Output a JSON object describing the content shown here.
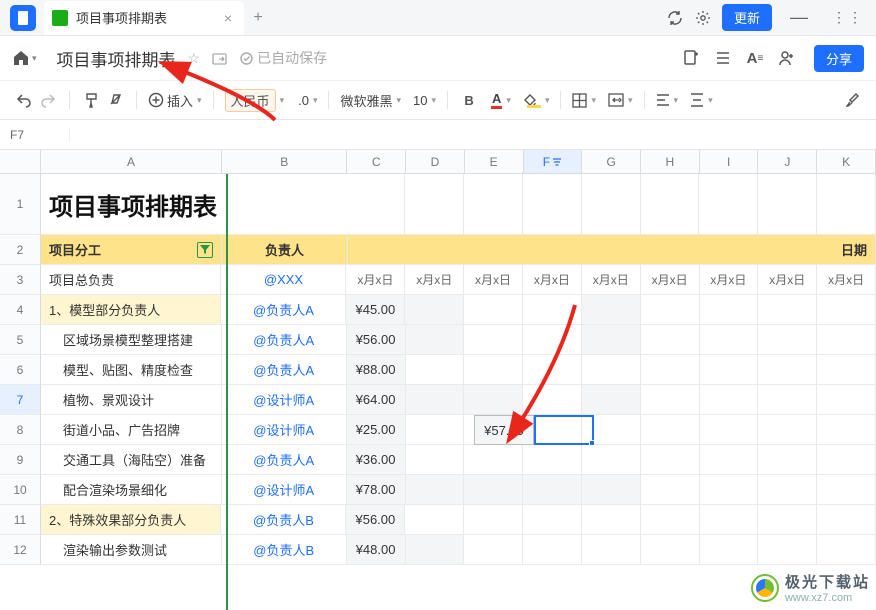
{
  "tabbar": {
    "title": "项目事项排期表",
    "update": "更新"
  },
  "titlebar": {
    "doc_title": "项目事项排期表",
    "autosave": "已自动保存",
    "share": "分享"
  },
  "toolbar": {
    "insert": "插入",
    "currency": "人民币",
    "decimal": ".0",
    "font": "微软雅黑",
    "font_size": "10"
  },
  "cellref": "F7",
  "columns": [
    "A",
    "B",
    "C",
    "D",
    "E",
    "F",
    "G",
    "H",
    "I",
    "J",
    "K"
  ],
  "rows": [
    "1",
    "2",
    "3",
    "4",
    "5",
    "6",
    "7",
    "8",
    "9",
    "10",
    "11",
    "12"
  ],
  "sheet": {
    "title": "项目事项排期表",
    "header": {
      "col_a": "项目分工",
      "col_b": "负责人",
      "col_date": "日期"
    },
    "date_header": "x月x日",
    "data": [
      {
        "task": "项目总负责",
        "owner": "@XXX",
        "amt": ""
      },
      {
        "task": "1、模型部分负责人",
        "owner": "@负责人A",
        "amt": "¥45.00",
        "sub": true
      },
      {
        "task": "区域场景模型整理搭建",
        "owner": "@负责人A",
        "amt": "¥56.00"
      },
      {
        "task": "模型、贴图、精度检查",
        "owner": "@负责人A",
        "amt": "¥88.00"
      },
      {
        "task": "植物、景观设计",
        "owner": "@设计师A",
        "amt": "¥64.00"
      },
      {
        "task": "街道小品、广告招牌",
        "owner": "@设计师A",
        "amt": "¥25.00"
      },
      {
        "task": "交通工具（海陆空）准备",
        "owner": "@负责人A",
        "amt": "¥36.00"
      },
      {
        "task": "配合渲染场景细化",
        "owner": "@设计师A",
        "amt": "¥78.00"
      },
      {
        "task": "2、特殊效果部分负责人",
        "owner": "@负责人B",
        "amt": "¥56.00",
        "sub": true
      },
      {
        "task": "渲染输出参数测试",
        "owner": "@负责人B",
        "amt": "¥48.00"
      }
    ],
    "e7": "¥57.00"
  },
  "watermark": {
    "line1": "极光下载站",
    "line2": "www.xz7.com"
  }
}
